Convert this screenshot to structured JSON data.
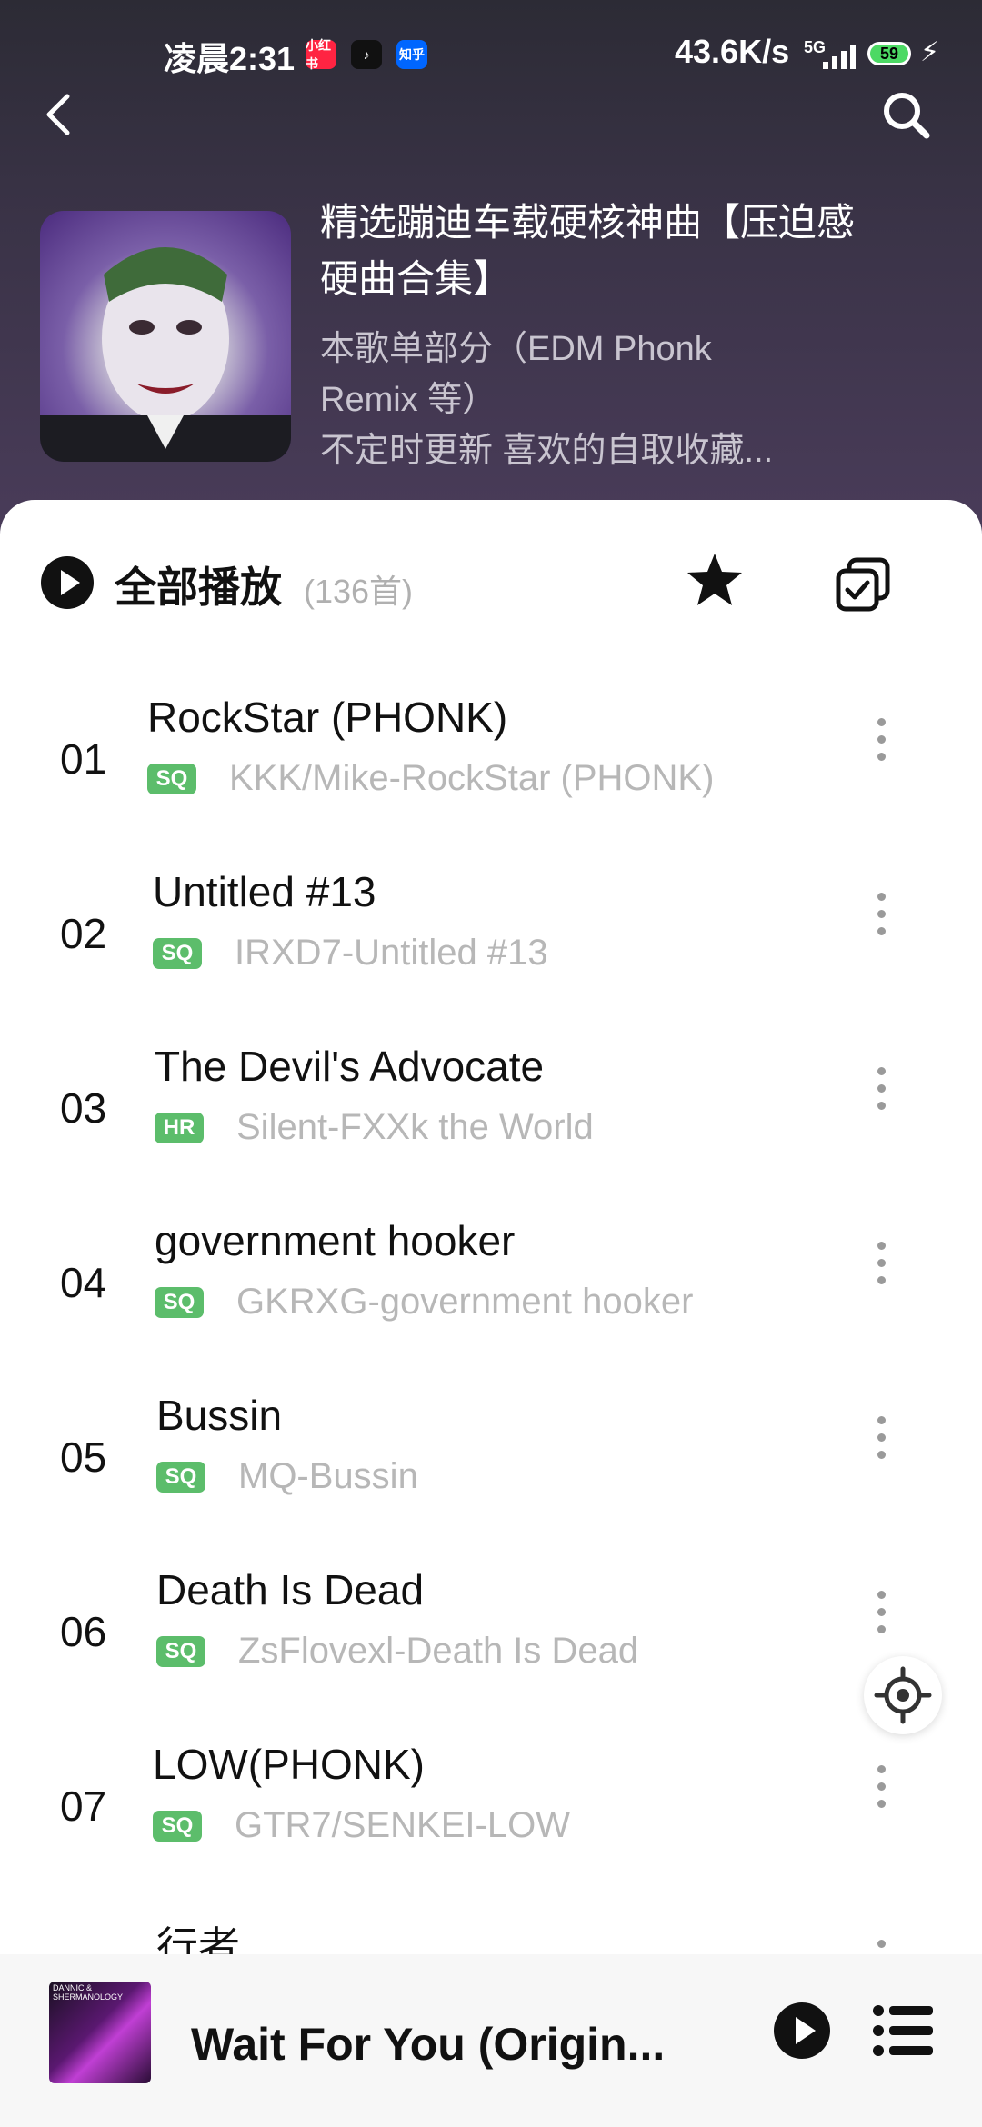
{
  "status_bar": {
    "time": "凌晨2:31",
    "apps": [
      {
        "label": "小红书",
        "color": "#ff2442"
      },
      {
        "label": "♪",
        "color": "#111111"
      },
      {
        "label": "知乎",
        "color": "#0066ff"
      }
    ],
    "network_speed": "43.6K/s",
    "signal_type": "5G",
    "battery": "59"
  },
  "playlist": {
    "title": "精选蹦迪车载硬核神曲【压迫感硬曲合集】",
    "description": "本歌单部分（EDM Phonk\nRemix 等）\n不定时更新 喜欢的自取收藏..."
  },
  "toolbar": {
    "play_all_label": "全部播放",
    "song_count": "(136首)"
  },
  "songs": [
    {
      "num": "01",
      "name": "RockStar (PHONK)",
      "badge": "SQ",
      "sub": "KKK/Mike-RockStar (PHONK)"
    },
    {
      "num": "02",
      "name": "Untitled #13",
      "badge": "SQ",
      "sub": "IRXD7-Untitled #13"
    },
    {
      "num": "03",
      "name": "The Devil's Advocate",
      "badge": "HR",
      "sub": "Silent-FXXk the World"
    },
    {
      "num": "04",
      "name": "government hooker",
      "badge": "SQ",
      "sub": "GKRXG-government hooker"
    },
    {
      "num": "05",
      "name": "Bussin",
      "badge": "SQ",
      "sub": "MQ-Bussin"
    },
    {
      "num": "06",
      "name": "Death Is Dead",
      "badge": "SQ",
      "sub": "ZsFlovexl-Death Is Dead"
    },
    {
      "num": "07",
      "name": "LOW(PHONK)",
      "badge": "SQ",
      "sub": "GTR7/SENKEI-LOW"
    },
    {
      "num": "",
      "name": "行者",
      "badge": "",
      "sub": ""
    }
  ],
  "now_playing": {
    "title": "Wait For You (Origin...",
    "art_caption": "DANNIC & SHERMANOLOGY"
  },
  "colors": {
    "quality_badge": "#5cbd6b",
    "accent_text": "#111111"
  }
}
